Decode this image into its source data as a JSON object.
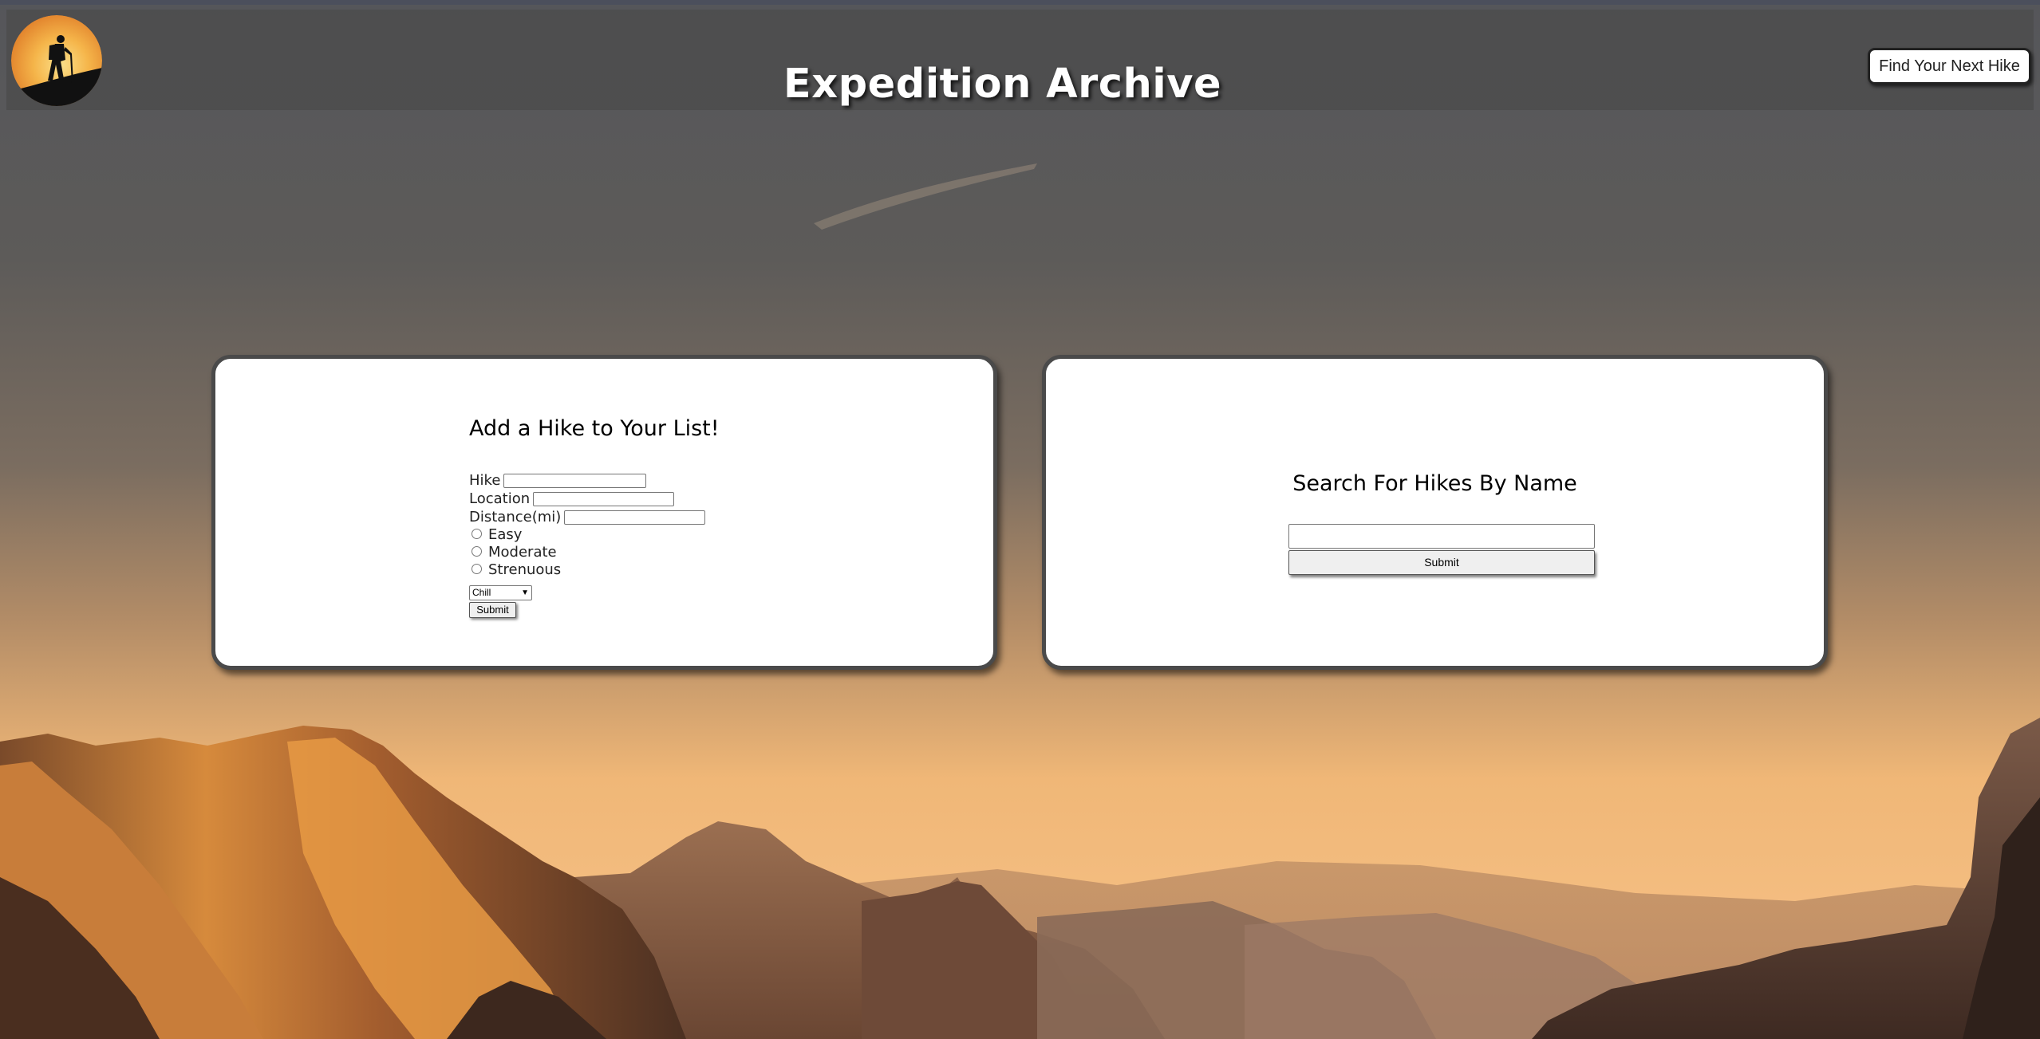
{
  "header": {
    "title": "Expedition Archive",
    "find_button_label": "Find Your Next Hike",
    "logo_icon": "hiker-silhouette-icon"
  },
  "add_form": {
    "heading": "Add a Hike to Your List!",
    "hike_label": "Hike",
    "hike_value": "",
    "location_label": "Location",
    "location_value": "",
    "distance_label": "Distance(mi)",
    "distance_value": "",
    "difficulty_options": [
      "Easy",
      "Moderate",
      "Strenuous"
    ],
    "vibe_selected": "Chill",
    "submit_label": "Submit"
  },
  "search_form": {
    "heading": "Search For Hikes By Name",
    "search_value": "",
    "submit_label": "Submit"
  },
  "colors": {
    "header_bg": "#4b4b4b",
    "card_border": "#4a4a4a",
    "sky_top": "#5b5a59",
    "sky_bottom": "#f4bb7a"
  }
}
